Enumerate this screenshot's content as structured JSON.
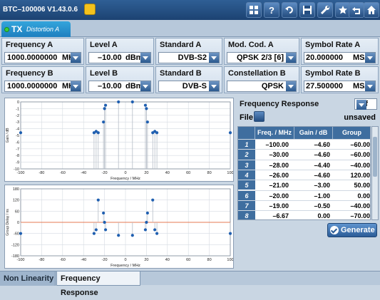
{
  "window": {
    "title": "BTC–100006 V1.43.0.6"
  },
  "tab": {
    "main": "TX",
    "sub": "Distortion A"
  },
  "params_row_a": [
    {
      "label": "Frequency A",
      "value": "1000.0000000",
      "unit": "MHz"
    },
    {
      "label": "Level A",
      "value": "–10.00",
      "unit": "dBm"
    },
    {
      "label": "Standard A",
      "value": "DVB-S2"
    },
    {
      "label": "Mod. Cod. A",
      "value": "QPSK 2/3 [6]"
    },
    {
      "label": "Symbol Rate A",
      "value": "20.000000",
      "unit": "MS/s"
    }
  ],
  "params_row_b": [
    {
      "label": "Frequency B",
      "value": "1000.0000000",
      "unit": "MHz"
    },
    {
      "label": "Level B",
      "value": "–10.00",
      "unit": "dBm"
    },
    {
      "label": "Standard B",
      "value": "DVB-S"
    },
    {
      "label": "Constellation B",
      "value": "QPSK"
    },
    {
      "label": "Symbol Rate B",
      "value": "27.500000",
      "unit": "MS/s"
    }
  ],
  "freq_response": {
    "title": "Frequency Response",
    "state": "Off",
    "file_label": "File",
    "file_status": "unsaved",
    "columns": [
      "Freq. / MHz",
      "Gain / dB",
      "Group Delay"
    ],
    "rows": [
      [
        "1",
        "–100.00",
        "–4.60",
        "–60.00"
      ],
      [
        "2",
        "–30.00",
        "–4.60",
        "–60.00"
      ],
      [
        "3",
        "–28.00",
        "–4.40",
        "–40.00"
      ],
      [
        "4",
        "–26.00",
        "–4.60",
        "120.00"
      ],
      [
        "5",
        "–21.00",
        "–3.00",
        "50.00"
      ],
      [
        "6",
        "–20.00",
        "–1.00",
        "0.00"
      ],
      [
        "7",
        "–19.00",
        "–0.50",
        "–40.00"
      ],
      [
        "8",
        "–6.67",
        "0.00",
        "–70.00"
      ]
    ],
    "generate_label": "Generate"
  },
  "bottom_tabs": [
    "Non Linearity",
    "Frequency Response"
  ],
  "chart_data": [
    {
      "type": "scatter",
      "title": "",
      "xlabel": "Frequency / MHz",
      "ylabel": "Gain / dB",
      "xlim": [
        -100,
        100
      ],
      "ylim": [
        -10,
        0
      ],
      "xticks": [
        -100,
        -80,
        -60,
        -40,
        -20,
        0,
        20,
        40,
        60,
        80,
        100
      ],
      "yticks": [
        0,
        -1,
        -2,
        -3,
        -4,
        -5,
        -6,
        -7,
        -8,
        -9,
        -10
      ],
      "grid": true,
      "points": [
        [
          -100,
          -4.6
        ],
        [
          -30,
          -4.6
        ],
        [
          -28,
          -4.4
        ],
        [
          -26,
          -4.6
        ],
        [
          -21,
          -3.0
        ],
        [
          -20,
          -1.0
        ],
        [
          -19,
          -0.5
        ],
        [
          -6.67,
          0.0
        ],
        [
          6.67,
          0.0
        ],
        [
          19,
          -0.5
        ],
        [
          20,
          -1.0
        ],
        [
          21,
          -3.0
        ],
        [
          26,
          -4.6
        ],
        [
          28,
          -4.4
        ],
        [
          30,
          -4.6
        ],
        [
          100,
          -4.6
        ]
      ]
    },
    {
      "type": "scatter",
      "title": "",
      "xlabel": "Frequency / MHz",
      "ylabel": "Group Delay / ns",
      "xlim": [
        -100,
        100
      ],
      "ylim": [
        -180,
        180
      ],
      "xticks": [
        -100,
        -80,
        -60,
        -40,
        -20,
        0,
        20,
        40,
        60,
        80,
        100
      ],
      "yticks": [
        180,
        120,
        60,
        0,
        -60,
        -120,
        -180
      ],
      "grid": true,
      "points": [
        [
          -100,
          -60
        ],
        [
          -30,
          -60
        ],
        [
          -28,
          -40
        ],
        [
          -26,
          120
        ],
        [
          -21,
          50
        ],
        [
          -20,
          0
        ],
        [
          -19,
          -40
        ],
        [
          -6.67,
          -70
        ],
        [
          6.67,
          -70
        ],
        [
          19,
          -40
        ],
        [
          20,
          0
        ],
        [
          21,
          50
        ],
        [
          26,
          120
        ],
        [
          28,
          -40
        ],
        [
          30,
          -60
        ],
        [
          100,
          -60
        ]
      ]
    }
  ],
  "colors": {
    "titlebar": "#1c4272",
    "accent": "#2b5c97",
    "point": "#1f5fb0",
    "zero_line": "#e5501f"
  }
}
